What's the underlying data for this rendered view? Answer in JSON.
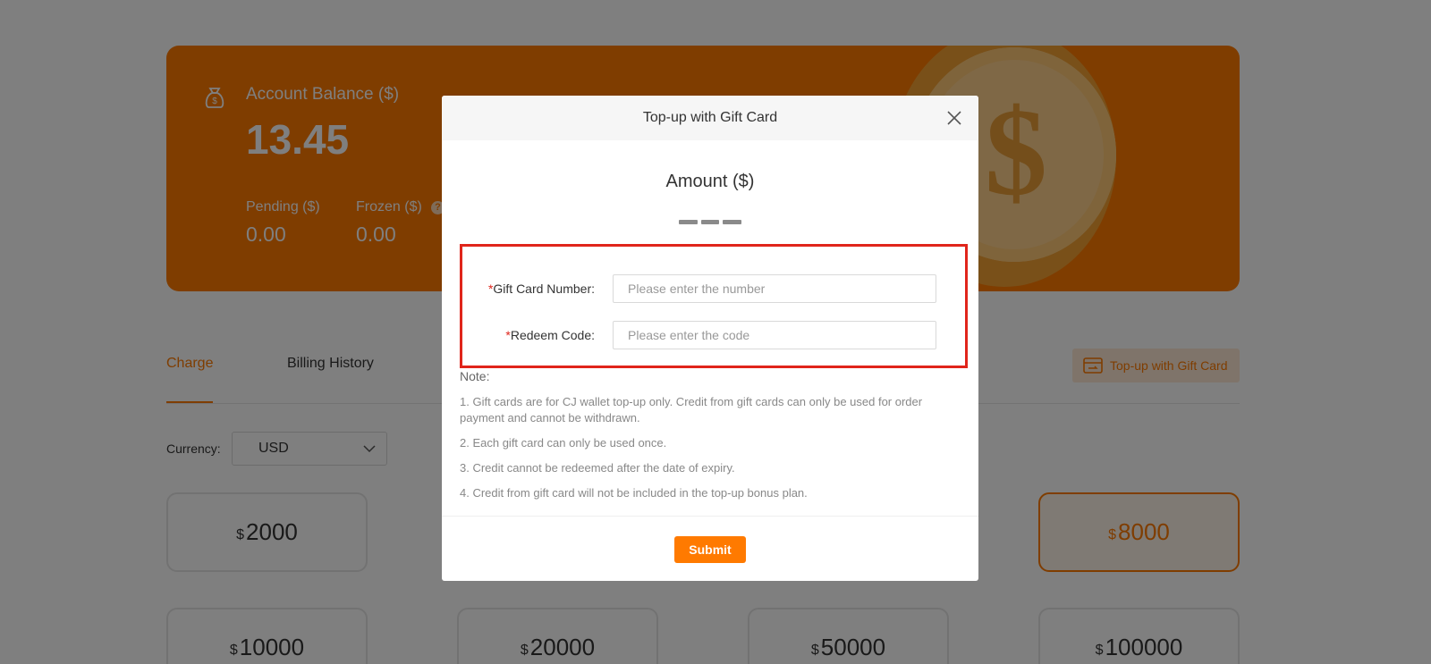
{
  "balance": {
    "label": "Account Balance ($)",
    "value": "13.45",
    "pending_label": "Pending ($)",
    "pending_value": "0.00",
    "frozen_label": "Frozen ($)",
    "frozen_value": "0.00",
    "help_glyph": "?",
    "coin_glyph": "$"
  },
  "tabs": {
    "charge": "Charge",
    "billing": "Billing History"
  },
  "giftcard_button": "Top-up with Gift Card",
  "currency": {
    "label": "Currency:",
    "value": "USD"
  },
  "amounts": [
    {
      "currency": "$",
      "value": "2000"
    },
    {
      "currency": "$",
      "value": "8000",
      "selected": true
    },
    {
      "currency": "$",
      "value": "10000"
    },
    {
      "currency": "$",
      "value": "20000"
    },
    {
      "currency": "$",
      "value": "50000"
    },
    {
      "currency": "$",
      "value": "100000"
    }
  ],
  "modal": {
    "title": "Top-up with Gift Card",
    "amount_title": "Amount ($)",
    "required_mark": "*",
    "card_number_label": "Gift Card Number:",
    "card_number_placeholder": "Please enter the number",
    "card_number_value": "",
    "redeem_label": "Redeem Code:",
    "redeem_placeholder": "Please enter the code",
    "redeem_value": "",
    "note_title": "Note:",
    "notes": [
      "1. Gift cards are for CJ wallet top-up only. Credit from gift cards can only be used for order payment and cannot be withdrawn.",
      "2. Each gift card can only be used once.",
      "3. Credit cannot be redeemed after the date of expiry.",
      "4. Credit from gift card will not be included in the top-up bonus plan."
    ],
    "submit": "Submit"
  },
  "colors": {
    "accent": "#ff7a00",
    "highlight_border": "#e0251b"
  }
}
